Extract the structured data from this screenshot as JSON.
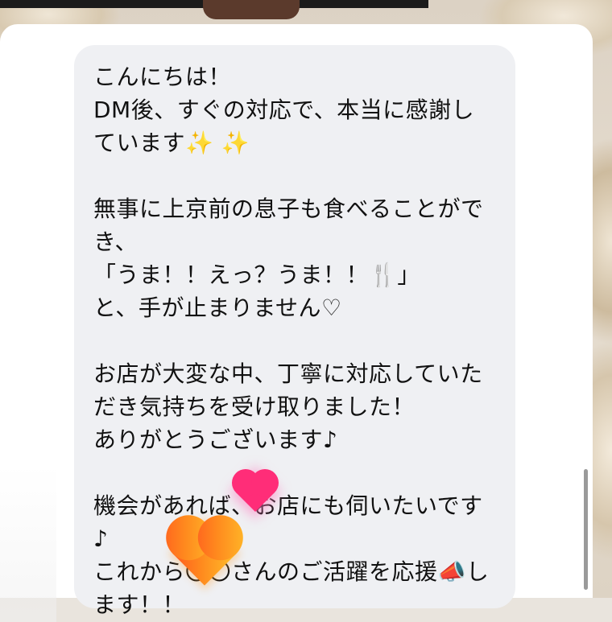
{
  "message": {
    "lines": [
      "こんにちは！",
      "DM後、すぐの対応で、本当に感謝し",
      "ています✨ ✨",
      "",
      "無事に上京前の息子も食べることがで",
      "き、",
      "「うま！！えっ？うま！！🍴」",
      "と、手が止まりません♡",
      "",
      "お店が大変な中、丁寧に対応していた",
      "だき気持ちを受け取りました！",
      "ありがとうございます♪",
      "",
      "機会があれば、お店にも伺いたいです",
      "♪",
      "これから〇〇さんのご活躍を応援📣し",
      "ます！！"
    ]
  },
  "stickers": {
    "pink_heart_icon": "heart-pink",
    "orange_heart_icon": "heart-orange"
  },
  "colors": {
    "bubble": "#eff0f3",
    "text": "#111111",
    "panel": "#ffffff",
    "pink_heart": "#ff2d78",
    "orange_heart": "#ff8a1e"
  }
}
